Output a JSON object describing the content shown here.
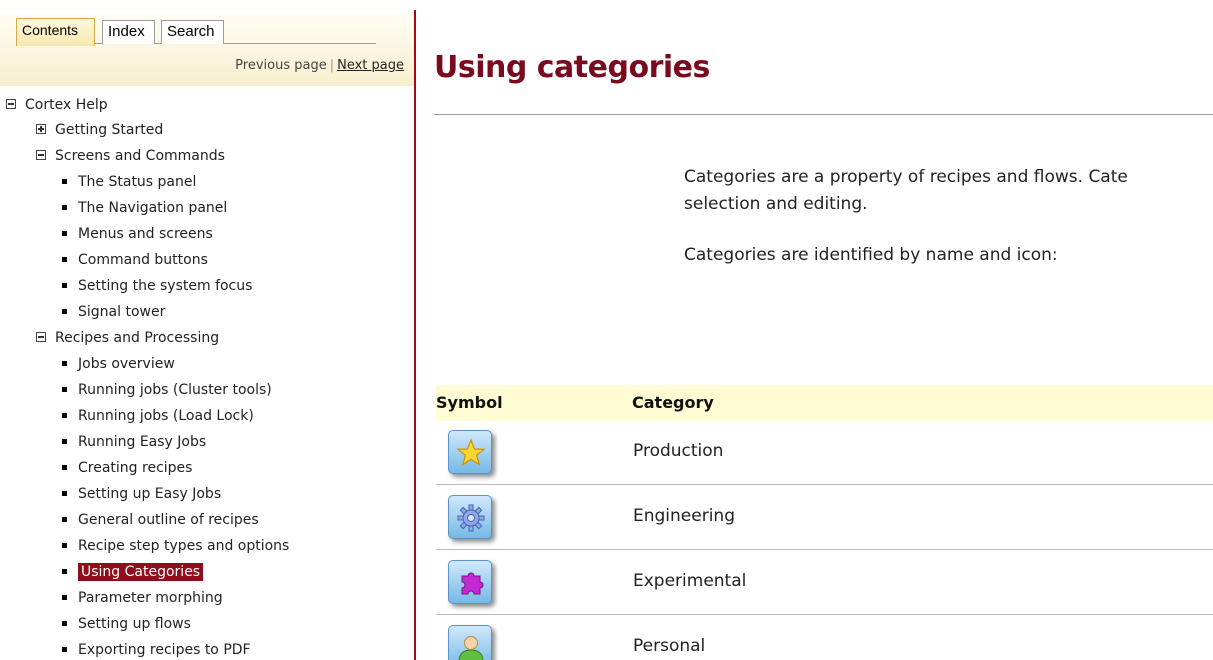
{
  "nav": {
    "tabs": [
      {
        "label": "Contents",
        "active": true
      },
      {
        "label": "Index",
        "active": false
      },
      {
        "label": "Search",
        "active": false
      }
    ],
    "previous_page": "Previous page",
    "separator": "|",
    "next_page": "Next page"
  },
  "tree": {
    "root": "Cortex Help",
    "getting_started": "Getting Started",
    "screens_and_commands": {
      "label": "Screens and Commands",
      "items": [
        "The Status panel",
        "The Navigation panel",
        "Menus and screens",
        "Command buttons",
        "Setting the system focus",
        "Signal tower"
      ]
    },
    "recipes_and_processing": {
      "label": "Recipes and Processing",
      "items": [
        "Jobs overview",
        "Running jobs (Cluster tools)",
        "Running jobs (Load Lock)",
        "Running Easy Jobs",
        "Creating recipes",
        "Setting up Easy Jobs",
        "General outline of recipes",
        "Recipe step types and options",
        "Using Categories",
        "Parameter morphing",
        "Setting up flows",
        "Exporting recipes to PDF"
      ]
    }
  },
  "content": {
    "title": "Using categories",
    "para1_line1": "Categories are a property of recipes and flows. Cate",
    "para1_line2": "selection and editing.",
    "para2": "Categories are identified by name and icon:",
    "table": {
      "headers": {
        "symbol": "Symbol",
        "category": "Category"
      },
      "rows": [
        {
          "icon": "star-icon",
          "category": "Production"
        },
        {
          "icon": "gear-icon",
          "category": "Engineering"
        },
        {
          "icon": "puzzle-icon",
          "category": "Experimental"
        },
        {
          "icon": "user-icon",
          "category": "Personal"
        }
      ]
    }
  },
  "colors": {
    "accent": "#a4081b",
    "title": "#7a0a1e",
    "selected_bg": "#8e0f1b",
    "table_header_bg": "#fffcd3"
  }
}
